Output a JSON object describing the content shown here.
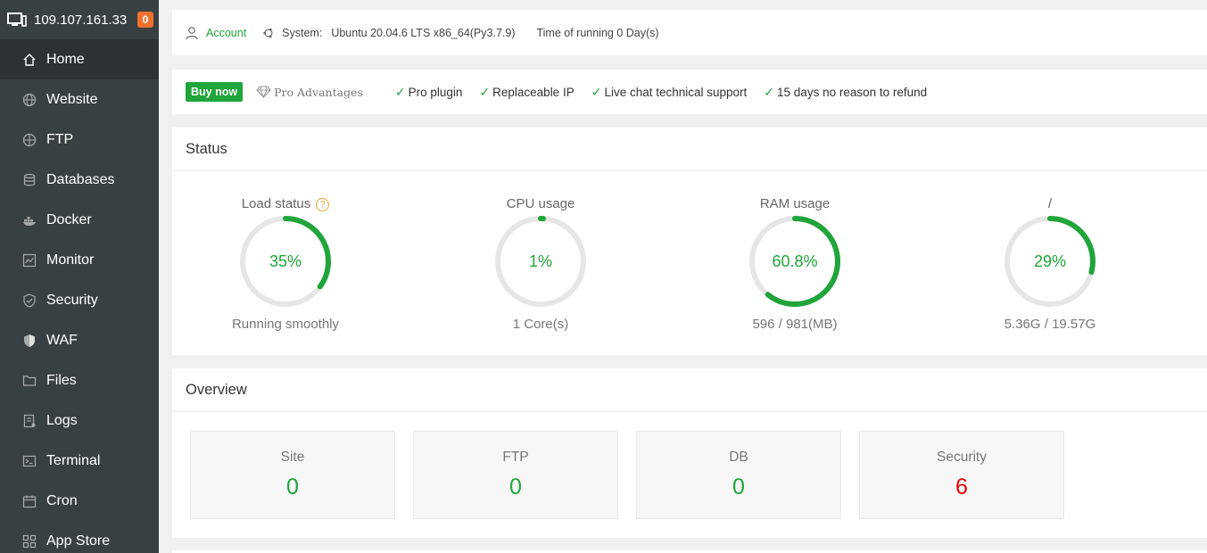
{
  "sidebar": {
    "ip": "109.107.161.33",
    "badge": "0",
    "items": [
      {
        "label": "Home",
        "icon": "home-icon"
      },
      {
        "label": "Website",
        "icon": "globe-icon"
      },
      {
        "label": "FTP",
        "icon": "ftp-icon"
      },
      {
        "label": "Databases",
        "icon": "database-icon"
      },
      {
        "label": "Docker",
        "icon": "docker-icon"
      },
      {
        "label": "Monitor",
        "icon": "monitor-chart-icon"
      },
      {
        "label": "Security",
        "icon": "shield-icon"
      },
      {
        "label": "WAF",
        "icon": "waf-shield-icon"
      },
      {
        "label": "Files",
        "icon": "folder-icon"
      },
      {
        "label": "Logs",
        "icon": "log-icon"
      },
      {
        "label": "Terminal",
        "icon": "terminal-icon"
      },
      {
        "label": "Cron",
        "icon": "calendar-icon"
      },
      {
        "label": "App Store",
        "icon": "grid-icon"
      }
    ]
  },
  "topbar": {
    "account": "Account",
    "system_label": "System:",
    "system_value": "Ubuntu 20.04.6 LTS x86_64(Py3.7.9)",
    "running": "Time of running 0 Day(s)"
  },
  "pro": {
    "buy": "Buy now",
    "advantages": "Pro Advantages",
    "features": [
      "Pro plugin",
      "Replaceable IP",
      "Live chat technical support",
      "15 days no reason to refund"
    ]
  },
  "status": {
    "title": "Status",
    "gauges": [
      {
        "title": "Load status",
        "value": "35%",
        "percent": 35,
        "sub": "Running smoothly"
      },
      {
        "title": "CPU usage",
        "value": "1%",
        "percent": 1,
        "sub": "1 Core(s)"
      },
      {
        "title": "RAM usage",
        "value": "60.8%",
        "percent": 60.8,
        "sub": "596 / 981(MB)"
      },
      {
        "title": "/",
        "value": "29%",
        "percent": 29,
        "sub": "5.36G / 19.57G"
      }
    ]
  },
  "overview": {
    "title": "Overview",
    "cards": [
      {
        "label": "Site",
        "value": "0"
      },
      {
        "label": "FTP",
        "value": "0"
      },
      {
        "label": "DB",
        "value": "0"
      },
      {
        "label": "Security",
        "value": "6"
      }
    ]
  },
  "colors": {
    "accent": "#20a53a",
    "sidebar": "#394044",
    "badge": "#f0712e",
    "danger": "#ee0000"
  }
}
